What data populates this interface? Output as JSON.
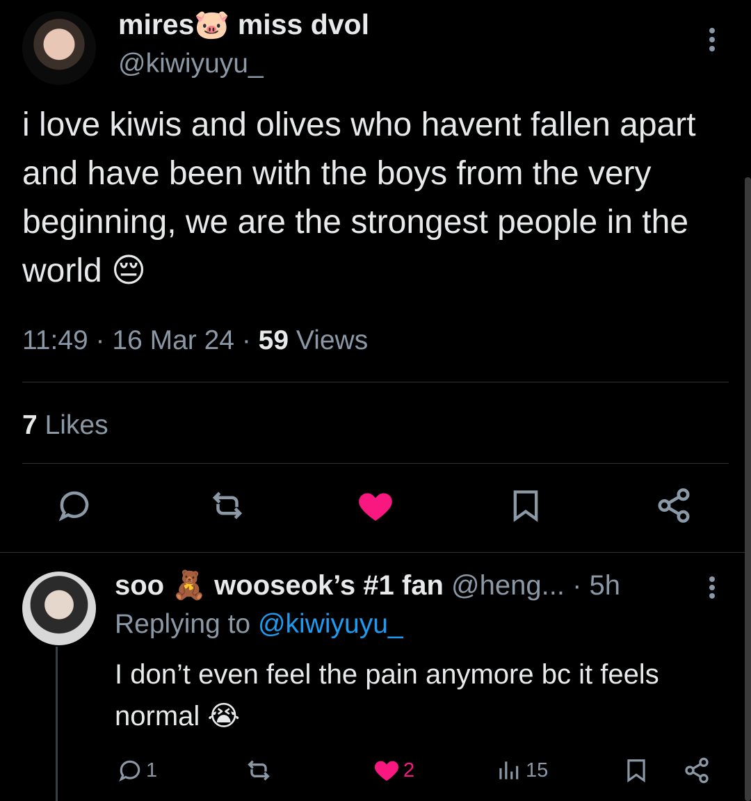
{
  "tweet": {
    "display_name": "mires🐷 miss dvol",
    "handle": "@kiwiyuyu_",
    "text": "i love kiwis and olives who havent fallen apart and have been with the boys from the very beginning, we are the strongest people in the world 😔",
    "time": "11:49",
    "date": "16 Mar 24",
    "views_count": "59",
    "views_label": "Views",
    "likes_count": "7",
    "likes_label": "Likes"
  },
  "reply": {
    "display_name": "soo 🧸 wooseok’s #1 fan",
    "handle": "@heng...",
    "time": "5h",
    "replying_prefix": "Replying to",
    "replying_to": "@kiwiyuyu_",
    "text": "I don’t even feel the pain anymore bc it feels normal 😭",
    "reply_count": "1",
    "like_count": "2",
    "views_count": "15"
  },
  "colors": {
    "accent": "#1d9bf0",
    "like": "#f91880",
    "muted": "#8b98a5",
    "text": "#e7e9ea",
    "background": "#000000"
  },
  "icons": [
    "more-vert-icon",
    "reply-icon",
    "retweet-icon",
    "heart-filled-icon",
    "bookmark-icon",
    "share-icon",
    "views-icon"
  ]
}
